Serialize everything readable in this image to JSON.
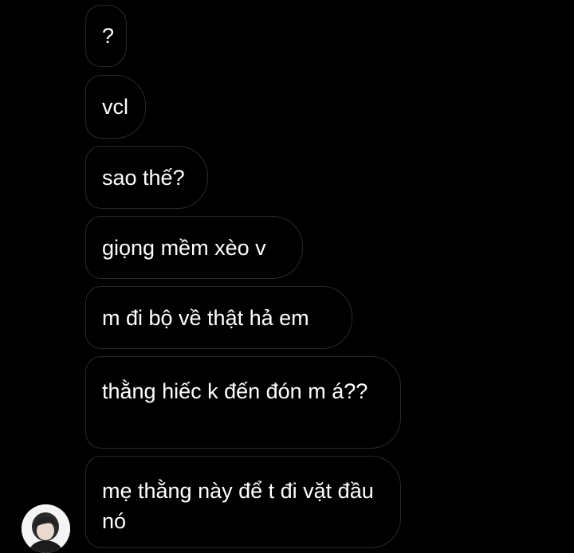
{
  "thread": {
    "messages": [
      {
        "text": "?"
      },
      {
        "text": "vcl"
      },
      {
        "text": "sao thế?"
      },
      {
        "text": "giọng mềm xèo v"
      },
      {
        "text": "m đi bộ về thật hả em"
      },
      {
        "text": "thằng hiếc k đến đón m á??"
      },
      {
        "text": "mẹ thằng này để t đi vặt đầu nó"
      }
    ]
  },
  "avatar": {
    "icon": "person-photo-icon"
  },
  "colors": {
    "background": "#000000",
    "bubble_border": "#2a2a2a",
    "text": "#ffffff"
  }
}
